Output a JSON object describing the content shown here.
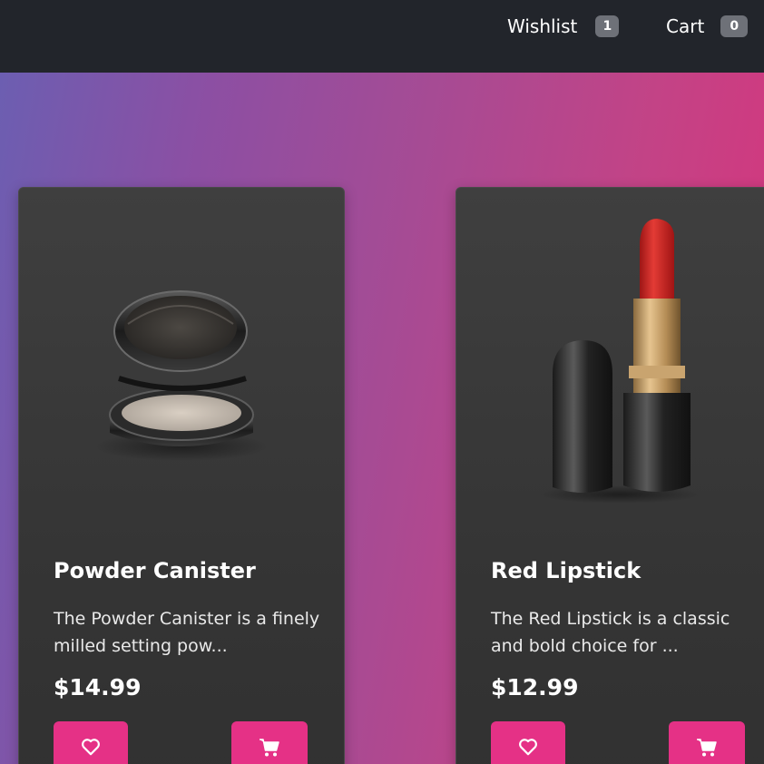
{
  "header": {
    "wishlist_label": "Wishlist",
    "wishlist_count": "1",
    "cart_label": "Cart",
    "cart_count": "0"
  },
  "products": [
    {
      "title": "Powder Canister",
      "description": "The Powder Canister is a finely milled setting pow...",
      "price": "$14.99"
    },
    {
      "title": "Red Lipstick",
      "description": "The Red Lipstick is a classic and bold choice for ...",
      "price": "$12.99"
    }
  ],
  "colors": {
    "header_bg": "#22252b",
    "accent": "#e53186",
    "card_bg": "#3a3a3a",
    "badge_bg": "#6e7178"
  },
  "icons": {
    "wishlist_button": "heart-icon",
    "cart_button": "cart-icon"
  }
}
